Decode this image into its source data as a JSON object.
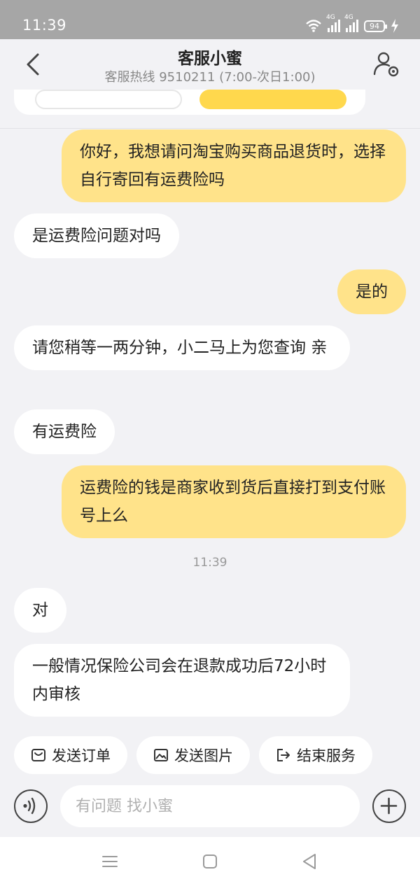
{
  "status_bar": {
    "time": "11:39",
    "network_1": "4G",
    "network_2": "4G",
    "battery": "94",
    "icons": [
      "wifi-icon",
      "signal-icon",
      "signal-icon",
      "battery-icon",
      "charging-icon"
    ]
  },
  "header": {
    "title": "客服小蜜",
    "subtitle": "客服热线 9510211 (7:00-次日1:00)",
    "icons": [
      "back-icon",
      "user-settings-icon"
    ]
  },
  "messages": [
    {
      "side": "out",
      "text": "你好，我想请问淘宝购买商品退货时，选择自行寄回有运费险吗"
    },
    {
      "side": "in",
      "text": "是运费险问题对吗"
    },
    {
      "side": "out",
      "text": "是的"
    },
    {
      "side": "in",
      "text": "请您稍等一两分钟，小二马上为您查询 亲"
    },
    {
      "side": "in",
      "text": "有运费险"
    },
    {
      "side": "out",
      "text": "运费险的钱是商家收到货后直接打到支付账号上么"
    },
    {
      "side": "in",
      "text": "对"
    },
    {
      "side": "in",
      "text": "一般情况保险公司会在退款成功后72小时内审核"
    }
  ],
  "timestamp": "11:39",
  "quick_actions": [
    {
      "label": "发送订单",
      "icon": "order-icon"
    },
    {
      "label": "发送图片",
      "icon": "image-icon"
    },
    {
      "label": "结束服务",
      "icon": "exit-icon"
    }
  ],
  "input": {
    "placeholder": "有问题 找小蜜",
    "value": ""
  },
  "nav": {
    "icons": [
      "menu-icon",
      "home-icon",
      "back-triangle-icon"
    ]
  },
  "colors": {
    "outgoing_bubble": "#ffe38a",
    "incoming_bubble": "#ffffff",
    "background": "#f2f2f5",
    "status_bar": "#a6a6a6"
  }
}
